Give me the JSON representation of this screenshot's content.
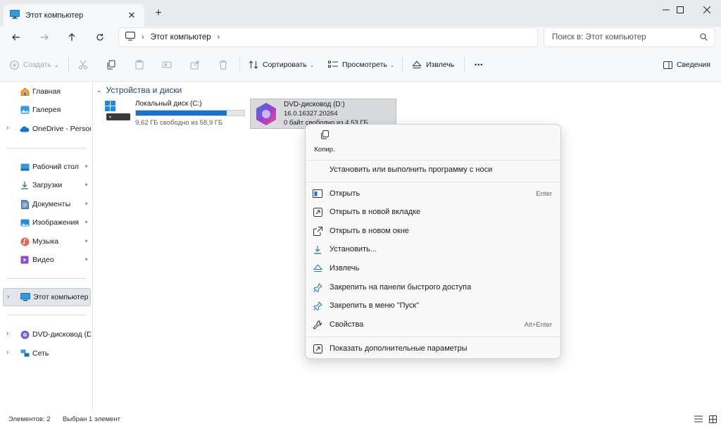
{
  "tab": {
    "title": "Этот компьютер",
    "close": "✕",
    "new_tab": "+"
  },
  "address": {
    "crumb": "Этот компьютер"
  },
  "search": {
    "placeholder": "Поиск в: Этот компьютер"
  },
  "toolbar": {
    "create": "Создать",
    "sort": "Сортировать",
    "view": "Просмотреть",
    "eject": "Извлечь",
    "more": "•••",
    "details": "Сведения"
  },
  "sidebar": {
    "home": "Главная",
    "gallery": "Галерея",
    "onedrive": "OneDrive - Persona",
    "desktop": "Рабочий стол",
    "downloads": "Загрузки",
    "documents": "Документы",
    "pictures": "Изображения",
    "music": "Музыка",
    "video": "Видео",
    "this_pc": "Этот компьютер",
    "dvd": "DVD-дисковод (D:)",
    "network": "Сеть"
  },
  "content": {
    "group_title": "Устройства и диски",
    "drive_c": {
      "name": "Локальный диск (C:)",
      "free": "9,62 ГБ свободно из 58,9 ГБ",
      "used_fraction": 0.837
    },
    "drive_d": {
      "name": "DVD-дисковод (D:)",
      "version": "16.0.16327.20264",
      "free": "0 байт свободно из 4,53 ГБ"
    }
  },
  "context_menu": {
    "copy": "Копир.",
    "install_run": "Установить или выполнить программу с носи",
    "open": "Открыть",
    "open_shortcut": "Enter",
    "open_new_tab": "Открыть в новой вкладке",
    "open_new_window": "Открыть в новом окне",
    "install": "Установить...",
    "eject": "Извлечь",
    "pin_quick": "Закрепить на панели быстрого доступа",
    "pin_start": "Закрепить в меню \"Пуск\"",
    "properties": "Свойства",
    "properties_shortcut": "Alt+Enter",
    "more_options": "Показать дополнительные параметры"
  },
  "status": {
    "items": "Элементов: 2",
    "selected": "Выбран 1 элемент"
  },
  "colors": {
    "accent": "#1a73c9",
    "group_title": "#20447a",
    "selection": "#d9dadd"
  }
}
